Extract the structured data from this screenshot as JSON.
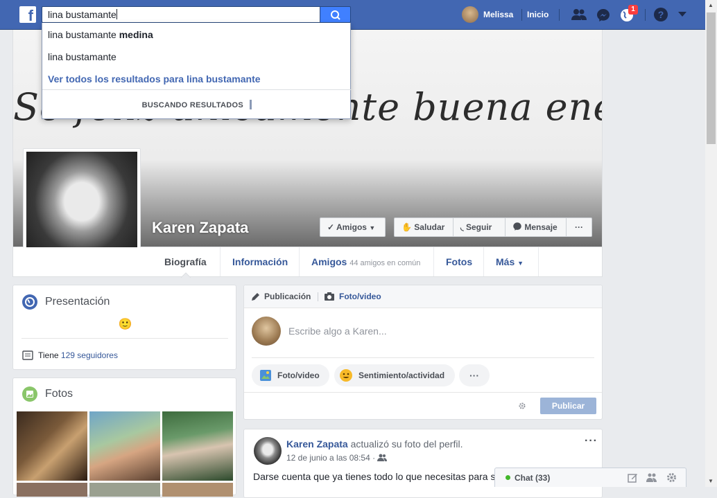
{
  "header": {
    "search_value": "lina bustamante",
    "user_name": "Melissa",
    "home_label": "Inicio",
    "notifications_count": "1"
  },
  "search_dropdown": {
    "items": [
      {
        "prefix": "lina bustamante ",
        "bold": "medina"
      },
      {
        "prefix": "lina bustamante",
        "bold": ""
      }
    ],
    "see_all": "Ver todos los resultados para lina bustamante",
    "loading": "BUSCANDO RESULTADOS"
  },
  "cover": {
    "text": "Sé feliz únicamente buena energía"
  },
  "profile": {
    "name": "Karen Zapata",
    "friends_button": "Amigos",
    "wave_button": "Saludar",
    "follow_button": "Seguir",
    "message_button": "Mensaje",
    "more_button": "···"
  },
  "tabs": [
    {
      "label": "Biografía",
      "sub": ""
    },
    {
      "label": "Información",
      "sub": ""
    },
    {
      "label": "Amigos",
      "sub": "44 amigos en común"
    },
    {
      "label": "Fotos",
      "sub": ""
    },
    {
      "label": "Más",
      "sub": ""
    }
  ],
  "intro": {
    "title": "Presentación",
    "emoji": "🙂",
    "followers_prefix": "Tiene",
    "followers_link": "129 seguidores"
  },
  "photos": {
    "title": "Fotos"
  },
  "composer": {
    "tab_post": "Publicación",
    "tab_photo": "Foto/video",
    "placeholder": "Escribe algo a Karen...",
    "btn_photo": "Foto/video",
    "btn_feeling": "Sentimiento/actividad",
    "btn_more": "···",
    "publish": "Publicar"
  },
  "post": {
    "author": "Karen Zapata",
    "action": "actualizó su foto del perfil.",
    "date": "12 de junio a las 08:54 ·",
    "text": "Darse cuenta que ya tienes todo lo que necesitas para s"
  },
  "chat": {
    "label": "Chat (33)"
  },
  "colors": {
    "brand": "#4267b2",
    "link": "#365899",
    "page_bg": "#e9ebee",
    "publish_disabled": "#9cb4d8"
  }
}
